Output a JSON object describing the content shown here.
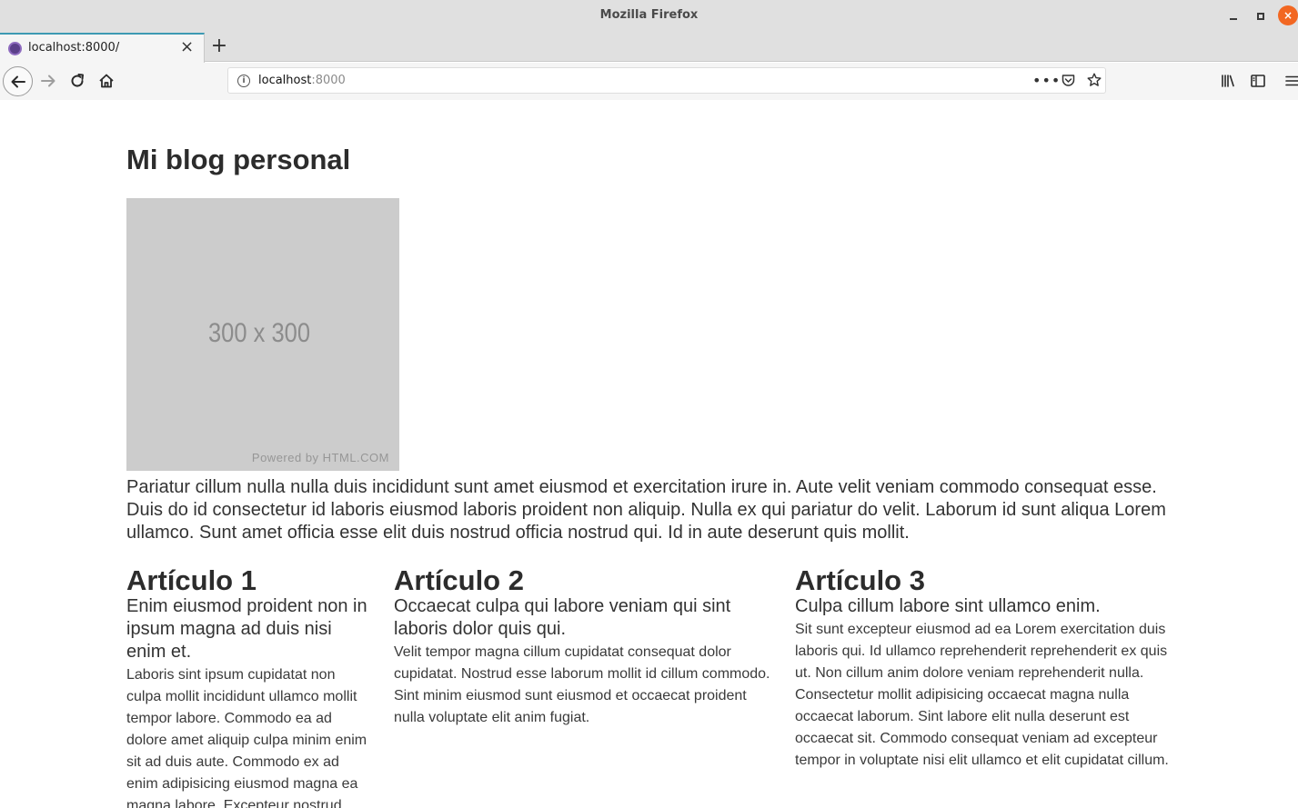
{
  "window": {
    "title": "Mozilla Firefox",
    "close_glyph": "×"
  },
  "tab": {
    "title": "localhost:8000/",
    "close_glyph": "×",
    "new_tab_glyph": "+"
  },
  "urlbar": {
    "host": "localhost",
    "port": ":8000",
    "page_actions_glyph": "•••",
    "info_glyph": "i"
  },
  "icons": {
    "back": "arrow-left-icon",
    "forward": "arrow-right-icon",
    "reload": "reload-icon",
    "home": "home-icon",
    "pocket": "pocket-icon",
    "bookmark": "star-icon",
    "library": "library-icon",
    "sidebar": "sidebar-icon",
    "menu": "hamburger-icon"
  },
  "page": {
    "title": "Mi blog personal",
    "image": {
      "size_text": "300 x 300",
      "credit": "Powered by HTML.COM"
    },
    "intro": "Pariatur cillum nulla nulla duis incididunt sunt amet eiusmod et exercitation irure in. Aute velit veniam commodo consequat esse. Duis do id consectetur id laboris eiusmod laboris proident non aliquip. Nulla ex qui pariatur do velit. Laborum id sunt aliqua Lorem ullamco. Sunt amet officia esse elit duis nostrud officia nostrud qui. Id in aute deserunt quis mollit.",
    "articles": [
      {
        "title": "Artículo 1",
        "subtitle": "Enim eiusmod proident non in ipsum magna ad duis nisi enim et.",
        "body": "Laboris sint ipsum cupidatat non culpa mollit incididunt ullamco mollit tempor labore. Commodo ea ad dolore amet aliquip culpa minim enim sit ad duis aute. Commodo ex ad enim adipisicing eiusmod magna ea magna labore. Excepteur nostrud."
      },
      {
        "title": "Artículo 2",
        "subtitle": "Occaecat culpa qui labore veniam qui sint laboris dolor quis qui.",
        "body": "Velit tempor magna cillum cupidatat consequat dolor cupidatat. Nostrud esse laborum mollit id cillum commodo. Sint minim eiusmod sunt eiusmod et occaecat proident nulla voluptate elit anim fugiat."
      },
      {
        "title": "Artículo 3",
        "subtitle": "Culpa cillum labore sint ullamco enim.",
        "body": "Sit sunt excepteur eiusmod ad ea Lorem exercitation duis laboris qui. Id ullamco reprehenderit reprehenderit ex quis ut. Non cillum anim dolore veniam reprehenderit nulla. Consectetur mollit adipisicing occaecat magna nulla occaecat laborum. Sint labore elit nulla deserunt est occaecat sit. Commodo consequat veniam ad excepteur tempor in voluptate nisi elit ullamco et elit cupidatat cillum."
      }
    ]
  },
  "colors": {
    "tab_accent": "#3d9ab3",
    "close_button": "#f26722",
    "placeholder_bg": "#cccccc"
  }
}
